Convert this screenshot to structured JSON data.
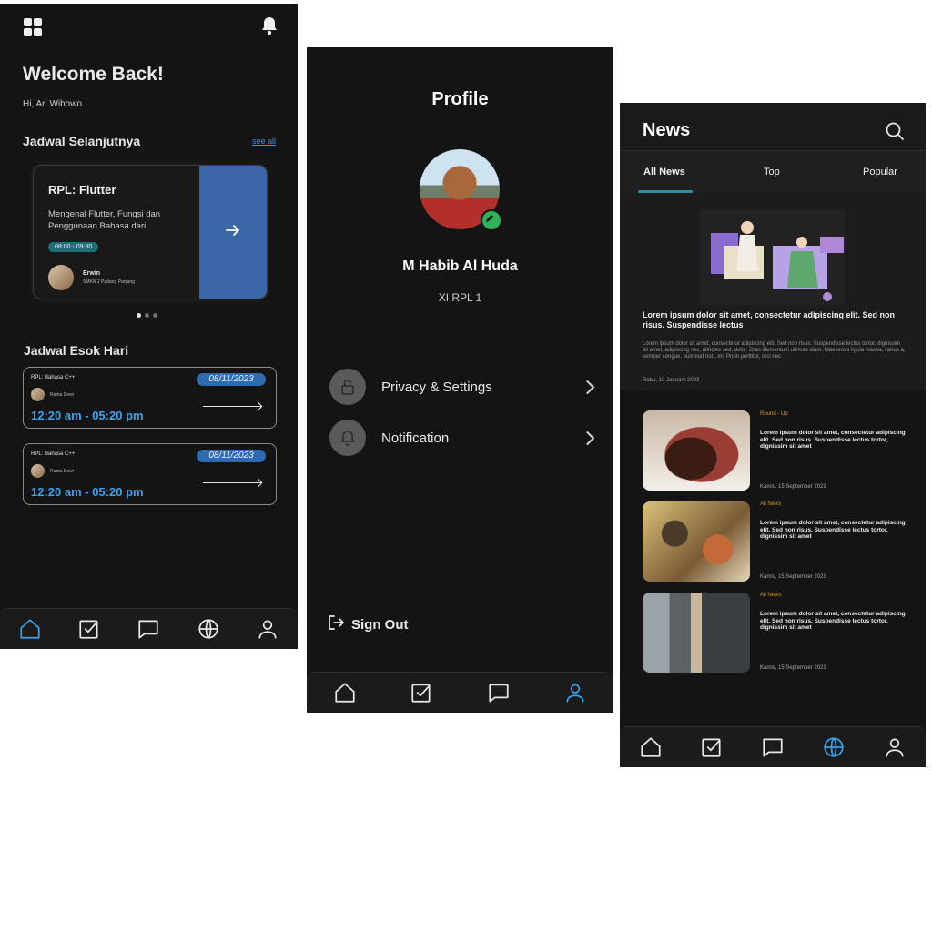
{
  "home": {
    "title": "Welcome Back!",
    "greeting": "Hi, Ari Wibowo",
    "next_section": "Jadwal Selanjutnya",
    "see_all": "see all",
    "featured": {
      "title": "RPL: Flutter",
      "description": "Mengenal Flutter, Fungsi dan Penggunaan Bahasa dari",
      "time": "08:00 - 09:30",
      "teacher": "Erwin",
      "school": "SMKN 2 Padang Panjang"
    },
    "tomorrow_section": "Jadwal Esok Hari",
    "schedules": [
      {
        "subject": "RPL: Bahasa C++",
        "date": "08/11/2023",
        "teacher": "Ratna Dewi",
        "time": "12:20 am - 05:20 pm"
      },
      {
        "subject": "RPL: Bahasa C++",
        "date": "08/11/2023",
        "teacher": "Ratna Dewi",
        "time": "12:20 am - 05:20 pm"
      }
    ]
  },
  "profile": {
    "title": "Profile",
    "name": "M Habib Al Huda",
    "class": "XI RPL 1",
    "menu": [
      {
        "label": "Privacy & Settings",
        "icon": "lock-icon"
      },
      {
        "label": "Notification",
        "icon": "bell-icon"
      }
    ],
    "sign_out": "Sign Out"
  },
  "news": {
    "title": "News",
    "tabs": [
      "All News",
      "Top",
      "Popular"
    ],
    "active_tab": "All News",
    "featured": {
      "title": "Lorem ipsum dolor sit amet, consectetur adipiscing elit. Sed non risus. Suspendisse lectus",
      "body": "Lorem ipsum dolor sit amet, consectetur adipiscing elit. Sed non risus. Suspendisse lectus tortor, dignissim sit amet, adipiscing nec, ultricies sed, dolor. Cras elementum ultrices diam. Maecenas ligula massa, varius a, semper congue, euismod non, mi. Proin porttitor, orci nec",
      "date": "Rabu, 10 January 2023"
    },
    "items": [
      {
        "category": "Round - Up",
        "title": "Lorem ipsum dolor sit amet, consectetur adipiscing elit. Sed non risus. Suspendisse lectus tortor, dignissim sit amet",
        "date": "Kamis, 15 September 2023"
      },
      {
        "category": "All News",
        "title": "Lorem ipsum dolor sit amet, consectetur adipiscing elit. Sed non risus. Suspendisse lectus tortor, dignissim sit amet",
        "date": "Kamis, 15 September 2023"
      },
      {
        "category": "All News",
        "title": "Lorem ipsum dolor sit amet, consectetur adipiscing elit. Sed non risus. Suspendisse lectus tortor, dignissim sit amet",
        "date": "Kamis, 15 September 2023"
      }
    ]
  },
  "nav_icons": [
    "home-icon",
    "tasks-icon",
    "chat-icon",
    "globe-icon",
    "user-icon"
  ],
  "colors": {
    "background": "#141414",
    "accent": "#3aa0e8",
    "card_blue": "#3a66a8",
    "category": "#d69b1c"
  }
}
